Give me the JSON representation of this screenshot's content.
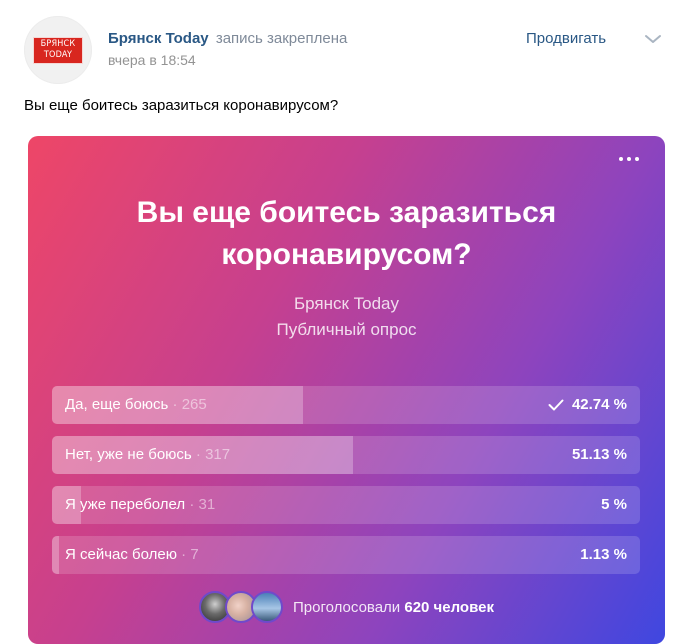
{
  "post": {
    "avatar_logo_line1": "БРЯНСК",
    "avatar_logo_line2": "TODAY",
    "author_name": "Брянск Today",
    "author_status": "запись закреплена",
    "time": "вчера в 18:54",
    "promote_label": "Продвигать",
    "text": "Вы еще боитесь заразиться коронавирусом?"
  },
  "poll": {
    "title": "Вы еще боитесь заразиться коронавирусом?",
    "author": "Брянск Today",
    "type": "Публичный опрос",
    "options": [
      {
        "label": "Да, еще боюсь",
        "count": "· 265",
        "percent": "42.74 %",
        "share": 0.4274,
        "voted": true
      },
      {
        "label": "Нет, уже не боюсь",
        "count": "· 317",
        "percent": "51.13 %",
        "share": 0.5113,
        "voted": false
      },
      {
        "label": "Я уже переболел",
        "count": "· 31",
        "percent": "5 %",
        "share": 0.05,
        "voted": false
      },
      {
        "label": "Я сейчас болею",
        "count": "· 7",
        "percent": "1.13 %",
        "share": 0.0113,
        "voted": false
      }
    ],
    "voters_prefix": "Проголосовали",
    "voters_count": "620 человек"
  },
  "colors": {
    "link": "#2a5885",
    "gradient_start": "#ee4667",
    "gradient_end": "#3f47e0"
  }
}
